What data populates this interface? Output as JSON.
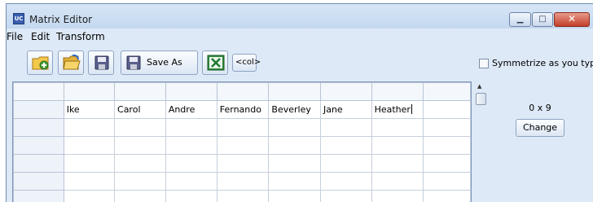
{
  "window": {
    "title": "Matrix Editor",
    "app_icon": "matrix-app-icon",
    "controls": [
      "minimize-icon",
      "maximize-icon",
      "close-icon"
    ]
  },
  "menu": [
    "File",
    "Edit",
    "Transform"
  ],
  "toolbar": {
    "buttons": [
      {
        "icon": "add-folder-icon"
      },
      {
        "icon": "open-folder-icon"
      },
      {
        "icon": "save-icon"
      },
      {
        "icon": "save-icon",
        "label": "Save As"
      },
      {
        "icon": "excel-icon"
      },
      {
        "label": "<col>"
      }
    ],
    "symmetrize": {
      "label": "Symmetrize as you type",
      "checked": false
    }
  },
  "grid": {
    "column_names": [
      "Ike",
      "Carol",
      "Andre",
      "Fernando",
      "Beverley",
      "Jane",
      "Heather"
    ],
    "editing_cell": "Heather",
    "visible_rows": 5
  },
  "side_panel": {
    "dimensions": "0 x 9",
    "change_label": "Change"
  },
  "colors": {
    "window_bg": "#dde9f6",
    "close_button": "#c2402a",
    "grid_border": "#c6cfdb"
  }
}
